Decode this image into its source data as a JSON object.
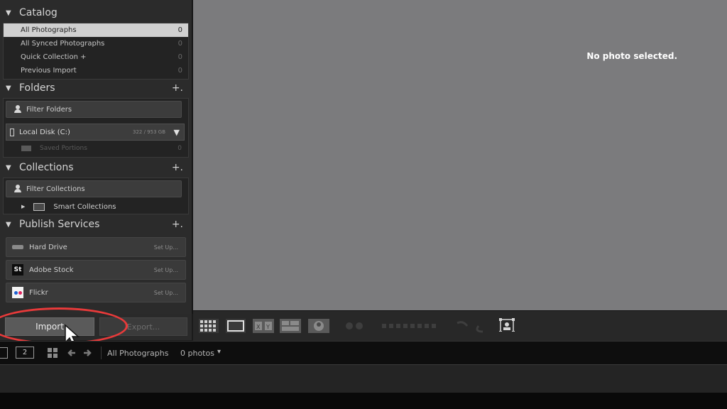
{
  "catalog": {
    "title": "Catalog",
    "items": [
      {
        "label": "All Photographs",
        "count": "0"
      },
      {
        "label": "All Synced Photographs",
        "count": "0"
      },
      {
        "label": "Quick Collection  +",
        "count": "0"
      },
      {
        "label": "Previous Import",
        "count": "0"
      }
    ]
  },
  "folders": {
    "title": "Folders",
    "plus": "+.",
    "filter_label": "Filter Folders",
    "disk_label": "Local Disk (C:)",
    "disk_space": "322 / 953 GB",
    "saved_label": "Saved Portions",
    "saved_count": "0"
  },
  "collections": {
    "title": "Collections",
    "plus": "+.",
    "filter_label": "Filter Collections",
    "smart_label": "Smart Collections"
  },
  "publish": {
    "title": "Publish Services",
    "plus": "+.",
    "services": [
      {
        "label": "Hard Drive",
        "setup": "Set Up...",
        "icon": "hard-drive-icon"
      },
      {
        "label": "Adobe Stock",
        "setup": "Set Up...",
        "icon": "adobe-stock-icon",
        "icon_text": "St"
      },
      {
        "label": "Flickr",
        "setup": "Set Up...",
        "icon": "flickr-icon"
      }
    ]
  },
  "main": {
    "empty_message": "No photo selected."
  },
  "buttons": {
    "import": "Import",
    "export": "Export..."
  },
  "filmstrip": {
    "screen_number": "2",
    "source": "All Photographs",
    "photo_count": "0 photos",
    "dropdown_arrow": "▾"
  },
  "colors": {
    "accent_highlight": "#e83a3a",
    "main_bg": "#7b7b7d",
    "panel_bg": "#2b2b2b"
  }
}
